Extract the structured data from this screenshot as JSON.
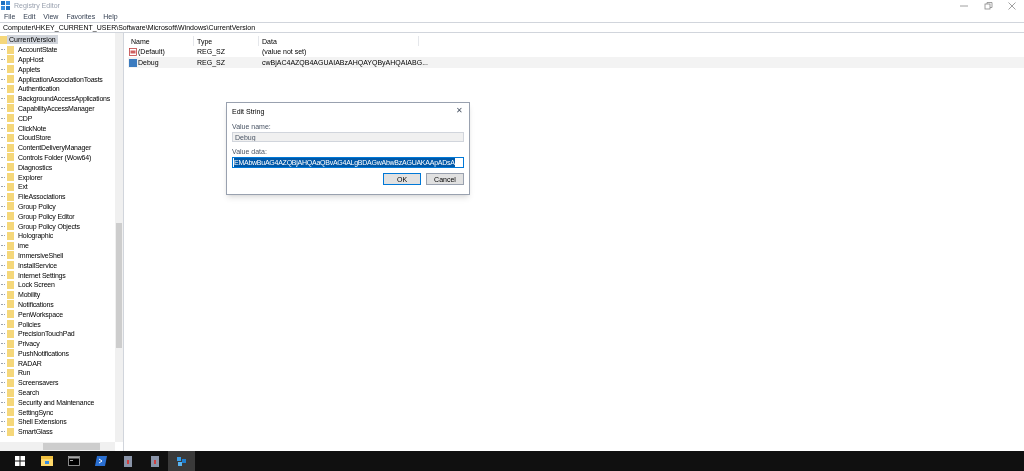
{
  "window": {
    "title": "Registry Editor"
  },
  "menu": [
    "File",
    "Edit",
    "View",
    "Favorites",
    "Help"
  ],
  "address": "Computer\\HKEY_CURRENT_USER\\Software\\Microsoft\\Windows\\CurrentVersion",
  "tree": {
    "label": "CurrentVersion",
    "selected": true,
    "children": [
      {
        "label": "AccountState",
        "selected": false
      },
      {
        "label": "AppHost",
        "selected": false
      },
      {
        "label": "Applets",
        "selected": false
      },
      {
        "label": "ApplicationAssociationToasts",
        "selected": false
      },
      {
        "label": "Authentication",
        "selected": false
      },
      {
        "label": "BackgroundAccessApplications",
        "selected": false
      },
      {
        "label": "CapabilityAccessManager",
        "selected": false
      },
      {
        "label": "CDP",
        "selected": false
      },
      {
        "label": "ClickNote",
        "selected": false
      },
      {
        "label": "CloudStore",
        "selected": false
      },
      {
        "label": "ContentDeliveryManager",
        "selected": false
      },
      {
        "label": "Controls Folder (Wow64)",
        "selected": false
      },
      {
        "label": "Diagnostics",
        "selected": false
      },
      {
        "label": "Explorer",
        "selected": false
      },
      {
        "label": "Ext",
        "selected": false
      },
      {
        "label": "FileAssociations",
        "selected": false
      },
      {
        "label": "Group Policy",
        "selected": false
      },
      {
        "label": "Group Policy Editor",
        "selected": false
      },
      {
        "label": "Group Policy Objects",
        "selected": false
      },
      {
        "label": "Holographic",
        "selected": false
      },
      {
        "label": "ime",
        "selected": false
      },
      {
        "label": "ImmersiveShell",
        "selected": false
      },
      {
        "label": "InstallService",
        "selected": false
      },
      {
        "label": "Internet Settings",
        "selected": false
      },
      {
        "label": "Lock Screen",
        "selected": false
      },
      {
        "label": "Mobility",
        "selected": false
      },
      {
        "label": "Notifications",
        "selected": false
      },
      {
        "label": "PenWorkspace",
        "selected": false
      },
      {
        "label": "Policies",
        "selected": false
      },
      {
        "label": "PrecisionTouchPad",
        "selected": false
      },
      {
        "label": "Privacy",
        "selected": false
      },
      {
        "label": "PushNotifications",
        "selected": false
      },
      {
        "label": "RADAR",
        "selected": false
      },
      {
        "label": "Run",
        "selected": false
      },
      {
        "label": "Screensavers",
        "selected": false
      },
      {
        "label": "Search",
        "selected": false
      },
      {
        "label": "Security and Maintenance",
        "selected": false
      },
      {
        "label": "SettingSync",
        "selected": false
      },
      {
        "label": "Shell Extensions",
        "selected": false
      },
      {
        "label": "SmartGlass",
        "selected": false
      }
    ]
  },
  "values": {
    "columns": [
      "Name",
      "Type",
      "Data"
    ],
    "rows": [
      {
        "name": "(Default)",
        "type": "REG_SZ",
        "data": "(value not set)",
        "selected": false
      },
      {
        "name": "Debug",
        "type": "REG_SZ",
        "data": "cwBjAC4AZQB4AGUAIABzAHQAYQByAHQAIABG...",
        "selected": true
      }
    ]
  },
  "dialog": {
    "title": "Edit String",
    "close": "✕",
    "name_label": "Value name:",
    "name_value": "Debug",
    "data_label": "Value data:",
    "data_value": "EMAbwBuAG4AZQBjAHQAaQBvAG4ALgBDAGwAbwBzAGUAKAApADsA",
    "data_selected": true,
    "buttons": [
      {
        "label": "OK",
        "default": true
      },
      {
        "label": "Cancel",
        "default": false
      }
    ]
  },
  "taskbar": [
    {
      "kind": "start",
      "active": false
    },
    {
      "kind": "folder",
      "active": false
    },
    {
      "kind": "console",
      "active": false
    },
    {
      "kind": "shell",
      "active": false
    },
    {
      "kind": "document",
      "active": false
    },
    {
      "kind": "document",
      "active": false
    },
    {
      "kind": "cubes",
      "active": true
    }
  ]
}
